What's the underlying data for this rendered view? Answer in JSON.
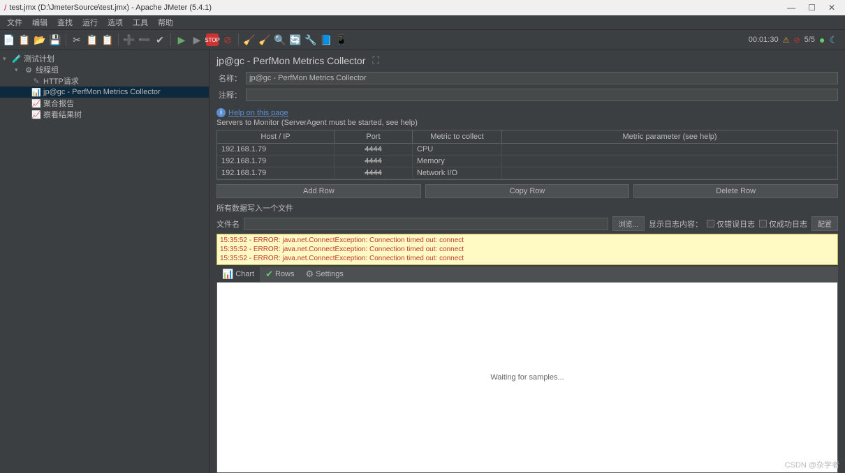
{
  "window": {
    "title": "test.jmx (D:\\JmeterSource\\test.jmx) - Apache JMeter (5.4.1)"
  },
  "menu": {
    "items": [
      "文件",
      "编辑",
      "查找",
      "运行",
      "选项",
      "工具",
      "帮助"
    ]
  },
  "toolbar_status": {
    "time": "00:01:30",
    "threads": "5/5"
  },
  "tree": {
    "root": "测试计划",
    "threadGroup": "线程组",
    "items": [
      "HTTP请求",
      "jp@gc - PerfMon Metrics Collector",
      "聚合报告",
      "察看结果树"
    ]
  },
  "panel": {
    "title": "jp@gc - PerfMon Metrics Collector",
    "name_label": "名称：",
    "name_value": "jp@gc - PerfMon Metrics Collector",
    "comment_label": "注释：",
    "help_link": "Help on this page",
    "servers_label": "Servers to Monitor (ServerAgent must be started, see help)",
    "headers": {
      "host": "Host / IP",
      "port": "Port",
      "metric": "Metric to collect",
      "param": "Metric parameter (see help)"
    },
    "rows": [
      {
        "host": "192.168.1.79",
        "port": "4444",
        "metric": "CPU",
        "param": ""
      },
      {
        "host": "192.168.1.79",
        "port": "4444",
        "metric": "Memory",
        "param": ""
      },
      {
        "host": "192.168.1.79",
        "port": "4444",
        "metric": "Network I/O",
        "param": ""
      }
    ],
    "buttons": {
      "add": "Add Row",
      "copy": "Copy Row",
      "delete": "Delete Row"
    },
    "file_section_label": "所有数据写入一个文件",
    "file_label": "文件名",
    "browse": "浏览...",
    "log_label": "显示日志内容：",
    "only_error": "仅错误日志",
    "only_success": "仅成功日志",
    "config": "配置",
    "errors": [
      "15:35:52 - ERROR: java.net.ConnectException: Connection timed out: connect",
      "15:35:52 - ERROR: java.net.ConnectException: Connection timed out: connect",
      "15:35:52 - ERROR: java.net.ConnectException: Connection timed out: connect"
    ],
    "tabs": {
      "chart": "Chart",
      "rows": "Rows",
      "settings": "Settings"
    },
    "chart_placeholder": "Waiting for samples...",
    "watermark": "CSDN @杂学者"
  }
}
